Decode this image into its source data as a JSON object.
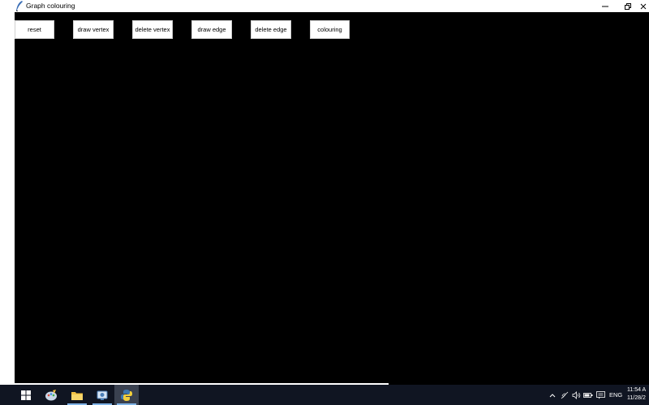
{
  "window": {
    "title": "Graph colouring"
  },
  "toolbar": {
    "buttons": [
      {
        "label": "reset"
      },
      {
        "label": "draw vertex"
      },
      {
        "label": "delete vertex"
      },
      {
        "label": "draw edge"
      },
      {
        "label": "delete edge"
      },
      {
        "label": "colouring"
      }
    ]
  },
  "canvas": {
    "background": "#000000"
  },
  "taskbar": {
    "icons": [
      "windows-start-icon",
      "paint-app-icon",
      "file-explorer-icon",
      "network-app-icon",
      "python-icon"
    ],
    "tray": {
      "language": "ENG",
      "time": "11:54 A",
      "date": "11/28/2"
    },
    "background": "#101522"
  }
}
